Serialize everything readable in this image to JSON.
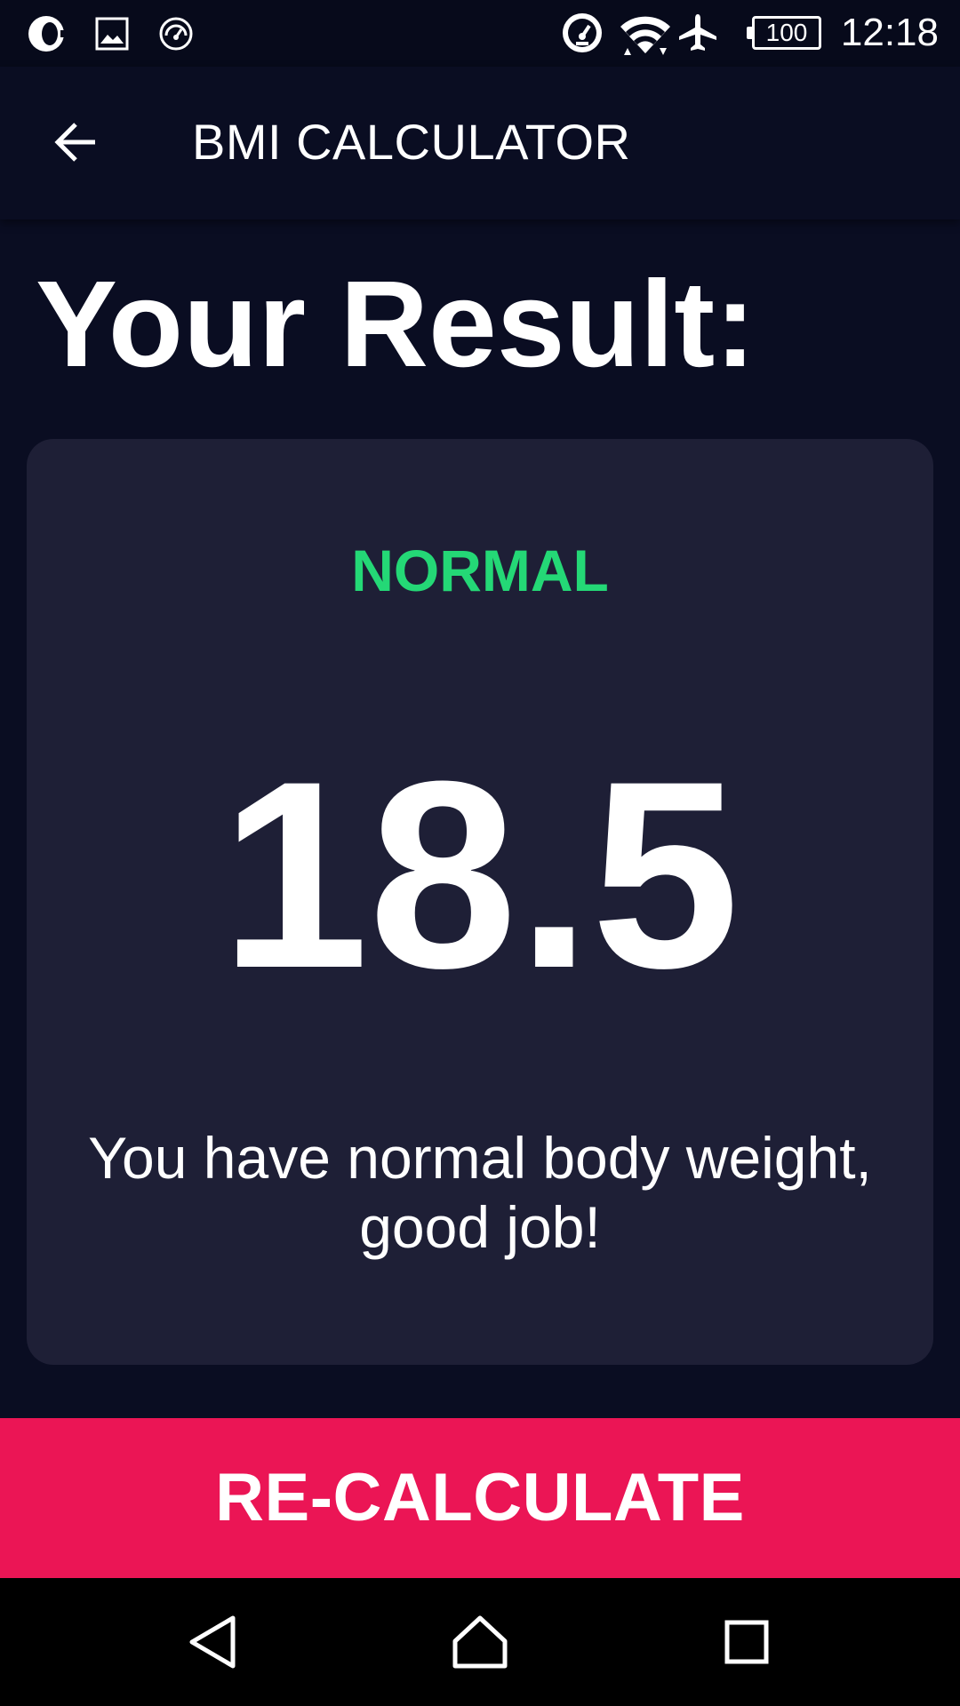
{
  "status_bar": {
    "time": "12:18",
    "battery_level": "100",
    "icons": [
      "opera-icon",
      "image-icon",
      "speedometer-icon",
      "data-saver-icon",
      "wifi-icon",
      "airplane-icon",
      "battery-icon"
    ]
  },
  "app_bar": {
    "title": "BMI CALCULATOR",
    "back_icon": "arrow-back-icon"
  },
  "main": {
    "heading": "Your Result:"
  },
  "result_card": {
    "status": "NORMAL",
    "bmi": "18.5",
    "interpretation": "You have normal body weight, good job!"
  },
  "actions": {
    "recalculate_label": "RE-CALCULATE"
  },
  "navigation": {
    "icons": [
      "nav-back-icon",
      "nav-home-icon",
      "nav-recents-icon"
    ]
  },
  "colors": {
    "background": "#0a0d22",
    "card": "#1e1f36",
    "status_text": "#24d876",
    "accent": "#eb1555"
  }
}
